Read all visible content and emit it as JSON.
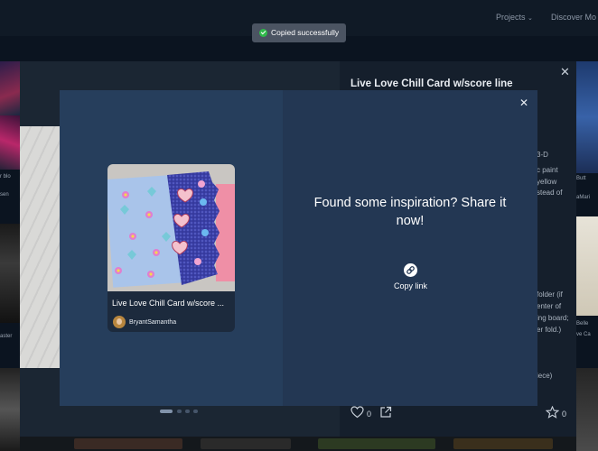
{
  "toast": {
    "message": "Copied successfully",
    "icon": "check-circle-icon",
    "color": "#2fba4a"
  },
  "top_nav": {
    "projects_label": "Projects",
    "discover_label": "Discover Mo"
  },
  "project_dialog": {
    "title": "Live Love Chill Card w/score line",
    "description_fragments": [
      "3-D",
      "c paint",
      "yellow",
      "stead of",
      "folder (if",
      "enter of",
      "ing board;",
      "er fold.)",
      "iece)"
    ],
    "like_count": "0",
    "favorite_count": "0",
    "carousel": {
      "total": 4,
      "active": 0
    }
  },
  "share_modal": {
    "heading": "Found some inspiration? Share it now!",
    "copy_link_label": "Copy link",
    "card": {
      "title": "Live Love Chill Card w/score ...",
      "username": "BryantSamantha"
    }
  },
  "background_labels": {
    "left": [
      "r blo",
      "sen",
      "aster"
    ],
    "right": [
      "Butt",
      "aMari",
      "Belle",
      "ve Ca"
    ]
  },
  "colors": {
    "accent": "#233753",
    "panel": "#263e5c",
    "toast_bg": "#4b5462"
  }
}
